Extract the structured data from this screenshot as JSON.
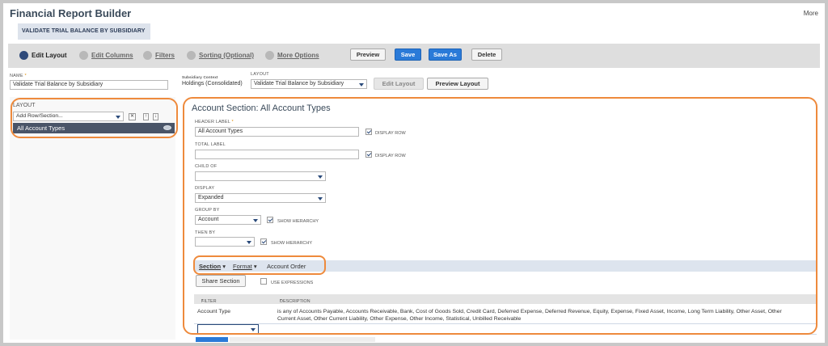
{
  "app": {
    "title": "Financial Report Builder",
    "more": "More"
  },
  "record": {
    "title": "VALIDATE TRIAL BALANCE BY SUBSIDIARY"
  },
  "wizard": {
    "steps": [
      {
        "label": "Edit Layout"
      },
      {
        "label": "Edit Columns"
      },
      {
        "label": "Filters"
      },
      {
        "label": "Sorting (Optional)"
      },
      {
        "label": "More Options"
      }
    ],
    "buttons": {
      "preview": "Preview",
      "save": "Save",
      "save_as": "Save As",
      "delete": "Delete"
    }
  },
  "form": {
    "name_label": "NAME",
    "name_value": "Validate Trial Balance by Subsidiary",
    "subsidiary_context_label": "Subsidiary Context",
    "subsidiary_context_value": "Holdings (Consolidated)",
    "layout_label": "LAYOUT",
    "layout_value": "Validate Trial Balance by Subsidiary",
    "edit_layout_button": "Edit Layout",
    "preview_layout_button": "Preview Layout"
  },
  "layout_panel": {
    "heading": "LAYOUT",
    "add_select_value": "Add Row/Section...",
    "selected_item": "All Account Types"
  },
  "section": {
    "title": "Account Section: All Account Types",
    "header_label": "HEADER LABEL",
    "header_value": "All Account Types",
    "display_row_1": "DISPLAY ROW",
    "total_label": "TOTAL LABEL",
    "total_value": "",
    "display_row_2": "DISPLAY ROW",
    "child_of_label": "CHILD OF",
    "child_of_value": "",
    "display_label": "DISPLAY",
    "display_value": "Expanded",
    "group_by_label": "GROUP BY",
    "group_by_value": "Account",
    "show_hierarchy_1": "SHOW HIERARCHY",
    "then_by_label": "THEN BY",
    "then_by_value": "",
    "show_hierarchy_2": "SHOW HIERARCHY"
  },
  "subtabs": [
    {
      "label": "Section"
    },
    {
      "label": "Format"
    },
    {
      "label": "Account Order"
    }
  ],
  "section_tab": {
    "share_button": "Share Section",
    "use_expressions": "USE EXPRESSIONS",
    "columns": {
      "filter": "FILTER",
      "description": "DESCRIPTION"
    },
    "rows": [
      {
        "filter": "Account Type",
        "description_line1": "is any of Accounts Payable, Accounts Receivable, Bank, Cost of Goods Sold, Credit Card, Deferred Expense, Deferred Revenue, Equity, Expense, Fixed Asset, Income, Long Term Liability, Other Asset, Other",
        "description_line2": "Current Asset, Other Current Liability, Other Expense, Other Income, Statistical, Unbilled Receivable"
      }
    ]
  },
  "colors": {
    "accent": "#ee8a3c",
    "primary_button": "#2a7ad8",
    "title": "#3a4a5a"
  }
}
